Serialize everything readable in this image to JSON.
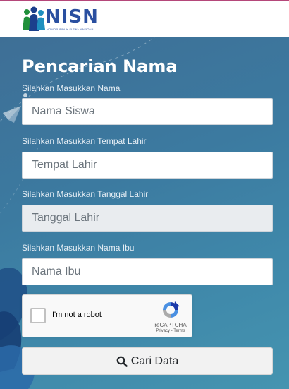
{
  "header": {
    "logo_text": "NISN",
    "logo_tagline": "NOMOR INDUK SISWA NASIONAL",
    "accent_color": "#b5477a"
  },
  "form": {
    "title": "Pencarian Nama",
    "nama": {
      "label": "Silahkan Masukkan Nama",
      "placeholder": "Nama Siswa",
      "value": ""
    },
    "tempat": {
      "label": "Silahkan Masukkan Tempat Lahir",
      "placeholder": "Tempat Lahir",
      "value": ""
    },
    "tanggal": {
      "label": "Silahkan Masukkan Tanggal Lahir",
      "placeholder": "Tanggal Lahir",
      "value": ""
    },
    "ibu": {
      "label": "Silahkan Masukkan Nama Ibu",
      "placeholder": "Nama Ibu",
      "value": ""
    },
    "captcha": {
      "label": "I'm not a robot",
      "brand": "reCAPTCHA",
      "links": "Privacy - Terms",
      "icon": "recaptcha-icon"
    },
    "submit": {
      "label": "Cari Data",
      "icon": "search-icon"
    }
  },
  "colors": {
    "background": "#3c7aa0",
    "button_bg": "#f2f2f2",
    "readonly_field": "#e9ecef"
  }
}
